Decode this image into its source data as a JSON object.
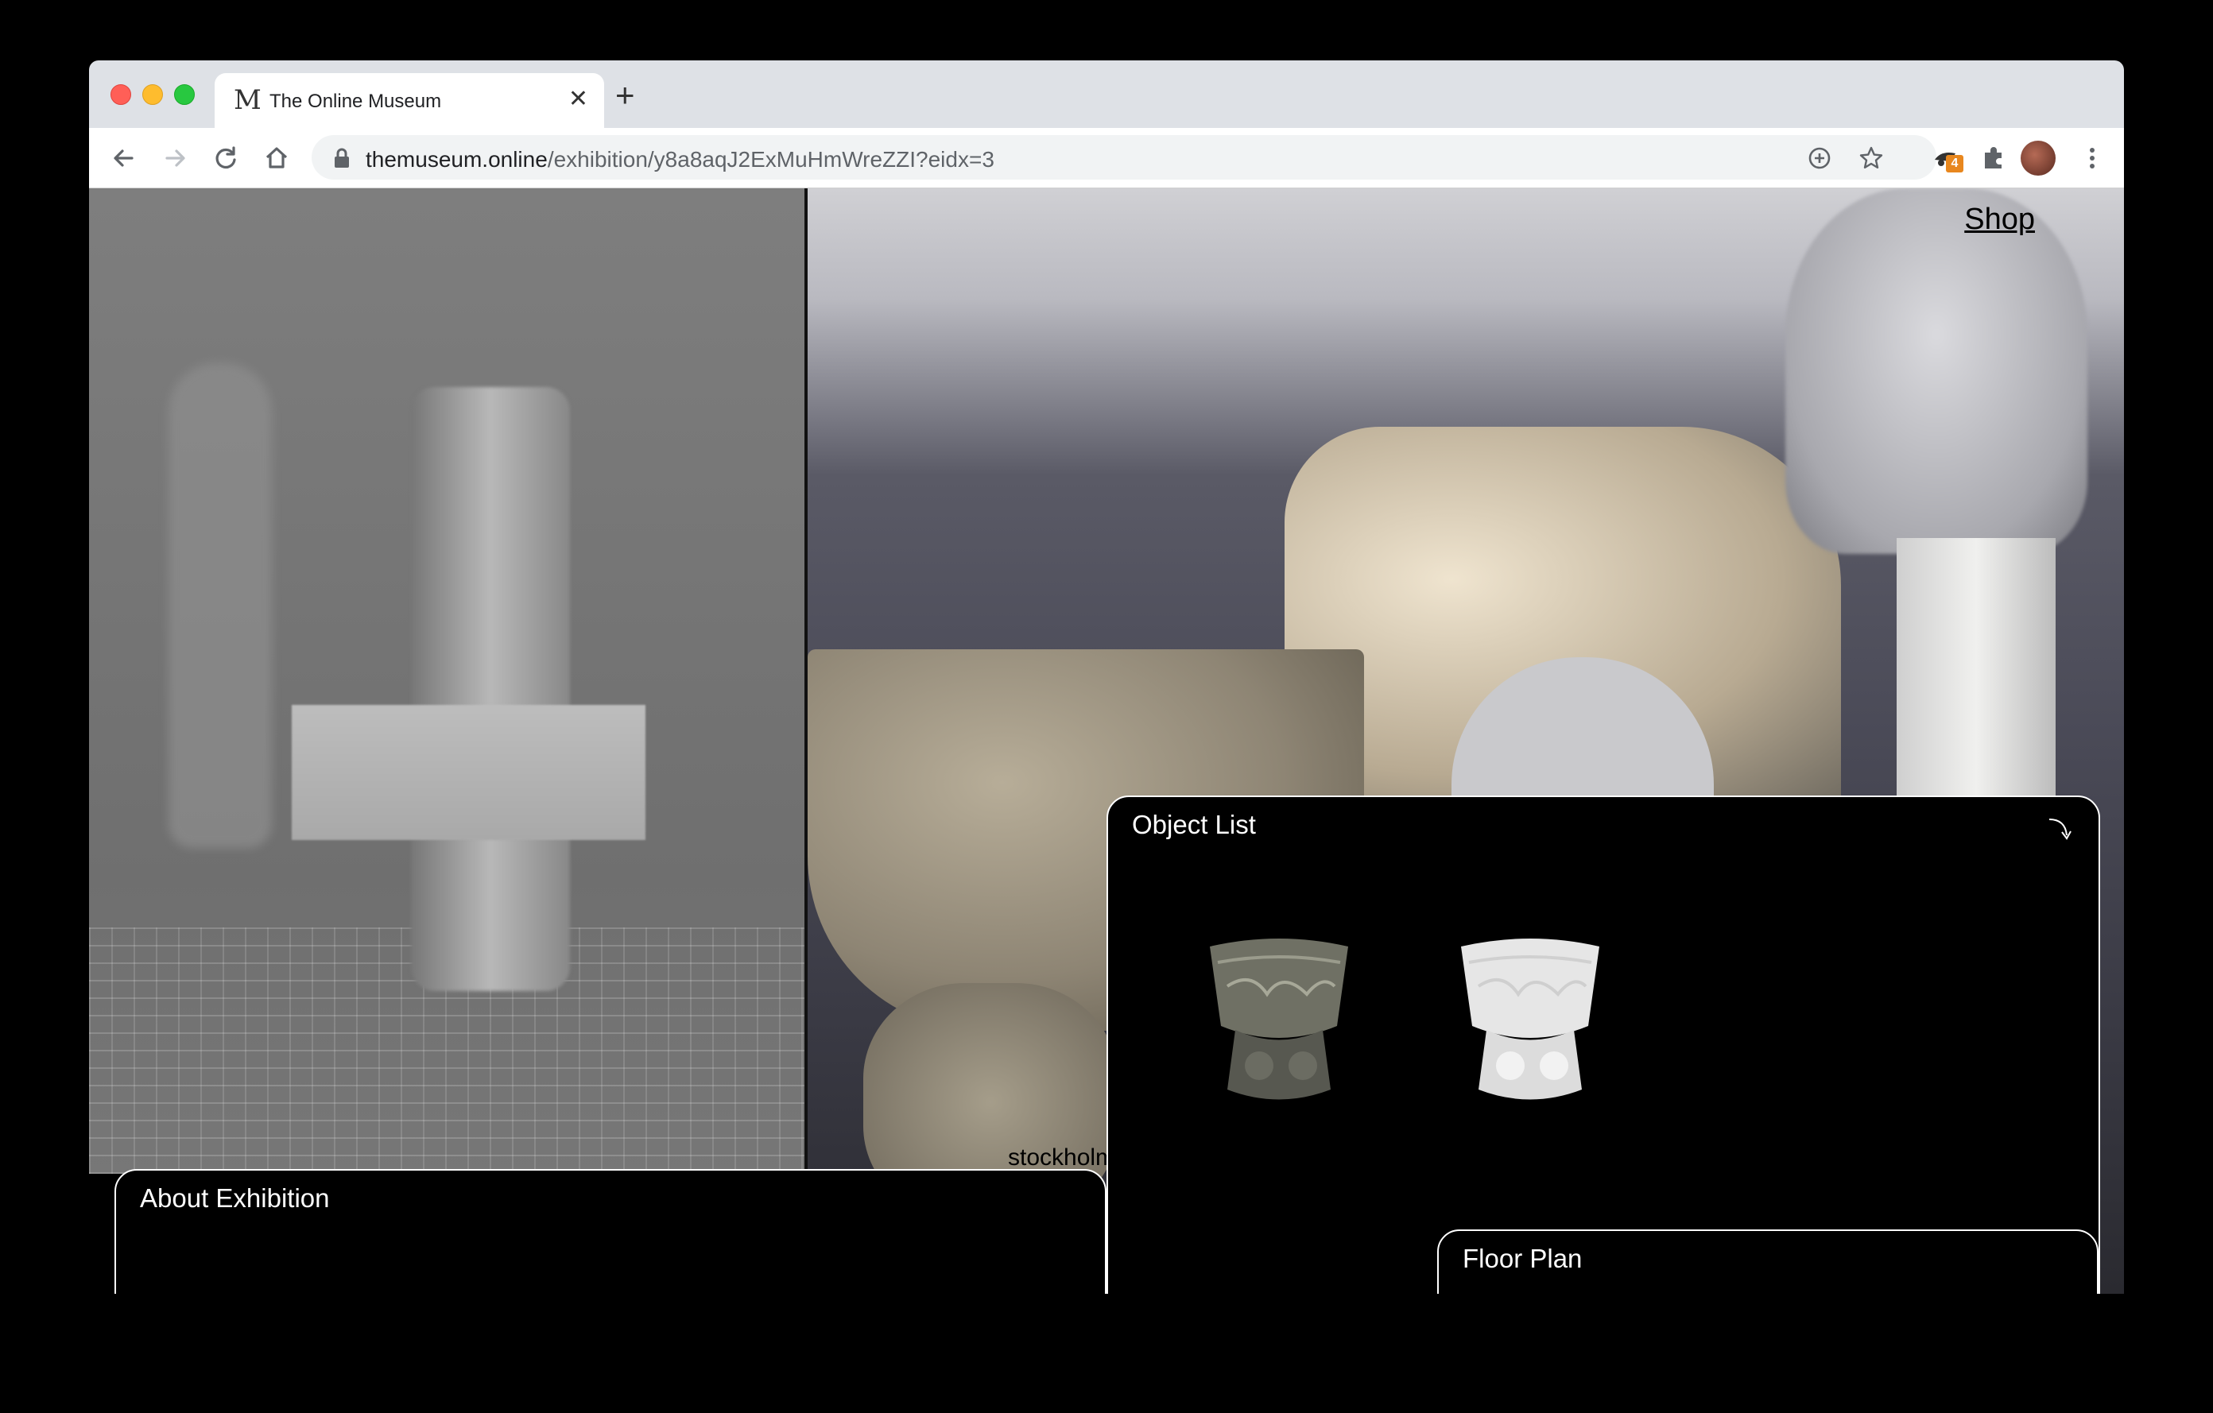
{
  "browser": {
    "tab": {
      "favicon": "M",
      "title": "The Online Museum"
    },
    "new_tab_label": "+",
    "close_tab_label": "✕",
    "url": {
      "domain": "themuseum.online",
      "path": "/exhibition/y8a8aqJ2ExMuHmWreZZI?eidx=3"
    },
    "extension_badge": "4",
    "icons": [
      "back-icon",
      "forward-icon",
      "reload-icon",
      "home-icon",
      "lock-icon",
      "add-to-page-icon",
      "bookmark-star-icon",
      "extension-icon",
      "puzzle-icon",
      "avatar",
      "kebab-menu-icon"
    ]
  },
  "page": {
    "shop_label": "Shop",
    "caption": "stockholm",
    "about_panel": {
      "title": "About Exhibition"
    },
    "object_list": {
      "title": "Object List",
      "items": [
        {
          "name": "stone baptismal font (textured)"
        },
        {
          "name": "stone baptismal font (white model)"
        }
      ]
    },
    "floor_plan": {
      "title": "Floor Plan"
    }
  }
}
